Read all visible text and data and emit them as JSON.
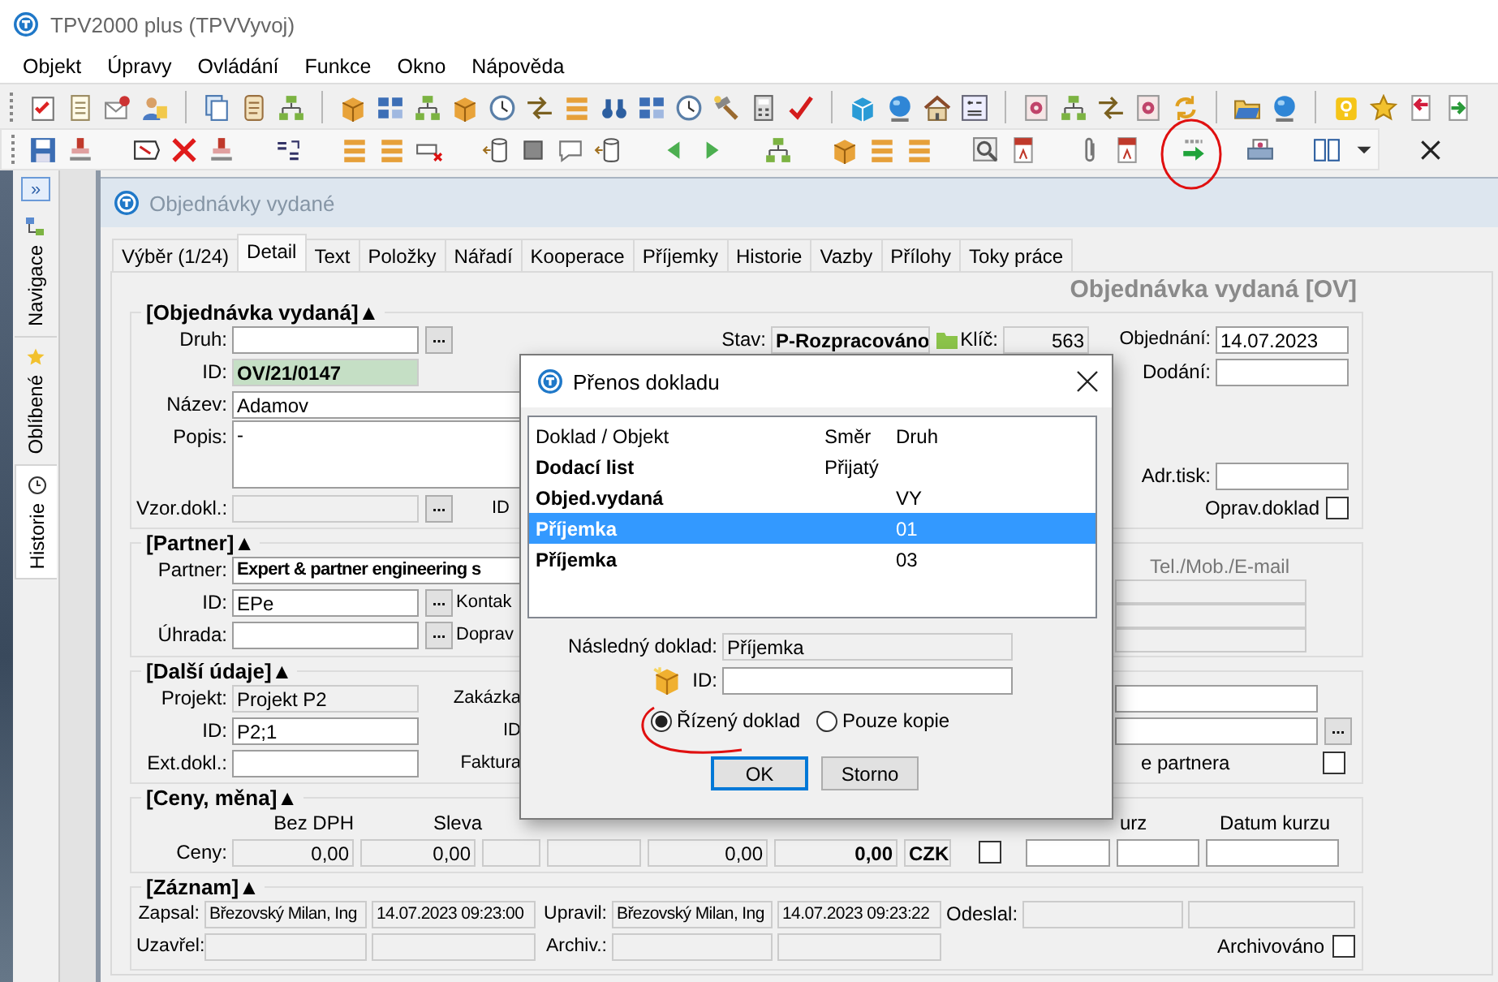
{
  "window": {
    "title": "TPV2000 plus (TPVVyvoj)"
  },
  "menu": [
    "Objekt",
    "Úpravy",
    "Ovládání",
    "Funkce",
    "Okno",
    "Nápověda"
  ],
  "side_panel": {
    "expand_button": "»",
    "tabs": [
      {
        "label": "Navigace",
        "selected": false
      },
      {
        "label": "Oblíbené",
        "selected": false
      },
      {
        "label": "Historie",
        "selected": true
      }
    ]
  },
  "document": {
    "title": "Objednávky vydané",
    "tabs": [
      {
        "label": "Výběr (1/24)",
        "selected": false
      },
      {
        "label": "Detail",
        "selected": true
      },
      {
        "label": "Text",
        "selected": false
      },
      {
        "label": "Položky",
        "selected": false
      },
      {
        "label": "Nářadí",
        "selected": false
      },
      {
        "label": "Kooperace",
        "selected": false
      },
      {
        "label": "Příjemky",
        "selected": false
      },
      {
        "label": "Historie",
        "selected": false
      },
      {
        "label": "Vazby",
        "selected": false
      },
      {
        "label": "Přílohy",
        "selected": false
      },
      {
        "label": "Toky práce",
        "selected": false
      }
    ]
  },
  "form": {
    "heading": "Objednávka vydaná [OV]",
    "order": {
      "title": "[Objednávka vydaná]▲",
      "druh": {
        "label": "Druh:",
        "button": "..."
      },
      "id": {
        "label": "ID:",
        "value": "OV/21/0147"
      },
      "name": {
        "label": "Název:",
        "value": "Adamov"
      },
      "description": {
        "label": "Popis:",
        "value": "-"
      },
      "template": {
        "label": "Vzor.dokl.:",
        "button": "...",
        "side_label": "ID"
      },
      "status": {
        "label": "Stav:",
        "value": "P-Rozpracováno"
      },
      "key": {
        "label": "Klíč:",
        "value": "563"
      },
      "ordered": {
        "label": "Objednání:",
        "value": "14.07.2023"
      },
      "delivered": {
        "label": "Dodání:"
      },
      "print_address": {
        "label": "Adr.tisk:"
      },
      "correction": {
        "label": "Oprav.doklad",
        "checked": false
      }
    },
    "partner": {
      "title": "[Partner]▲",
      "partner": {
        "label": "Partner:",
        "value": "Expert & partner engineering s"
      },
      "id": {
        "label": "ID:",
        "value": "EPe",
        "button": "...",
        "side_label": "Kontak"
      },
      "payment": {
        "label": "Úhrada:",
        "button": "...",
        "side_label": "Doprav"
      },
      "contact_header": "Tel./Mob./E-mail"
    },
    "other": {
      "title": "[Další údaje]▲",
      "project": {
        "label": "Projekt:",
        "value": "Projekt P2",
        "side_label": "Zakázka"
      },
      "id": {
        "label": "ID:",
        "value": "P2;1",
        "side_label": "ID"
      },
      "external": {
        "label": "Ext.dokl.:",
        "side_label": "Faktura"
      },
      "right_button": "...",
      "partner_flag": {
        "label": "e partnera",
        "checked": false
      }
    },
    "prices": {
      "title": "[Ceny, měna]▲",
      "headers": [
        "Bez DPH",
        "Sleva"
      ],
      "right_headers": [
        "urz",
        "Datum kurzu"
      ],
      "label": "Ceny:",
      "net": "0,00",
      "discount": "0,00",
      "total_1": "0,00",
      "total_2": "0,00",
      "currency": "CZK",
      "flag_checked": false
    },
    "record": {
      "title": "[Záznam]▲",
      "created": {
        "label": "Zapsal:",
        "user": "Březovský Milan, Ing",
        "time": "14.07.2023 09:23:00"
      },
      "modified": {
        "label": "Upravil:",
        "user": "Březovský Milan, Ing",
        "time": "14.07.2023 09:23:22"
      },
      "sent": {
        "label": "Odeslal:"
      },
      "closed": {
        "label": "Uzavřel:"
      },
      "archived_by": {
        "label": "Archiv.:"
      },
      "archived": {
        "label": "Archivováno",
        "checked": false
      }
    }
  },
  "dialog": {
    "title": "Přenos dokladu",
    "columns": [
      "Doklad / Objekt",
      "Směr",
      "Druh"
    ],
    "rows": [
      {
        "document": "Dodací list",
        "direction": "Přijatý",
        "selected": false
      },
      {
        "document": "Objed.vydaná",
        "type": "VY",
        "selected": false
      },
      {
        "document": "Příjemka",
        "type": "01",
        "selected": true
      },
      {
        "document": "Příjemka",
        "type": "03",
        "selected": false
      }
    ],
    "next_document": {
      "label": "Následný doklad:",
      "value": "Příjemka"
    },
    "id": {
      "label": "ID:"
    },
    "options": [
      {
        "label": "Řízený doklad",
        "selected": true
      },
      {
        "label": "Pouze kopie",
        "selected": false
      }
    ],
    "buttons": [
      {
        "label": "OK",
        "default": true
      },
      {
        "label": "Storno",
        "default": false
      }
    ]
  }
}
